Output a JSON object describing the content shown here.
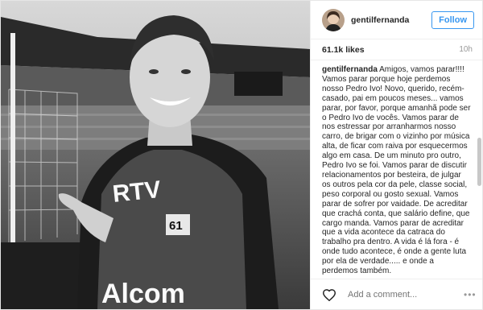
{
  "post": {
    "username": "gentilfernanda",
    "follow_label": "Follow",
    "likes": "61.1k likes",
    "time": "10h",
    "caption_user": "gentilfernanda",
    "caption_text": "Amigos, vamos parar!!!! Vamos parar porque hoje perdemos nosso Pedro Ivo! Novo, querido, recém-casado, pai em poucos meses... vamos parar, por favor, porque amanhã pode ser o Pedro Ivo de vocês. Vamos parar de nos estressar por arranharmos nosso carro, de brigar com o vizinho por música alta, de ficar com raiva por esquecermos algo em casa. De um minuto pro outro, Pedro Ivo se foi. Vamos parar de discutir relacionamentos por besteira, de julgar os outros pela cor da pele, classe social, peso corporal ou gosto sexual. Vamos parar de sofrer por vaidade. De acreditar que crachá conta, que salário define, que cargo manda. Vamos parar de acreditar que a vida acontece da catraca do trabalho pra dentro. A vida é lá fora - é onde tudo acontece, é onde a gente luta por ela de verdade..... e onde a perdemos também.",
    "comment_placeholder": "Add a comment...",
    "more_label": "•••",
    "photo": {
      "vest_brand": "RTV",
      "vest_number": "61",
      "vest_sponsor": "Alcom"
    }
  },
  "icons": {
    "heart": "heart-outline-icon",
    "more": "more-options-icon"
  },
  "colors": {
    "accent": "#3897f0",
    "text": "#262626",
    "muted": "#999999",
    "border": "#efefef"
  }
}
